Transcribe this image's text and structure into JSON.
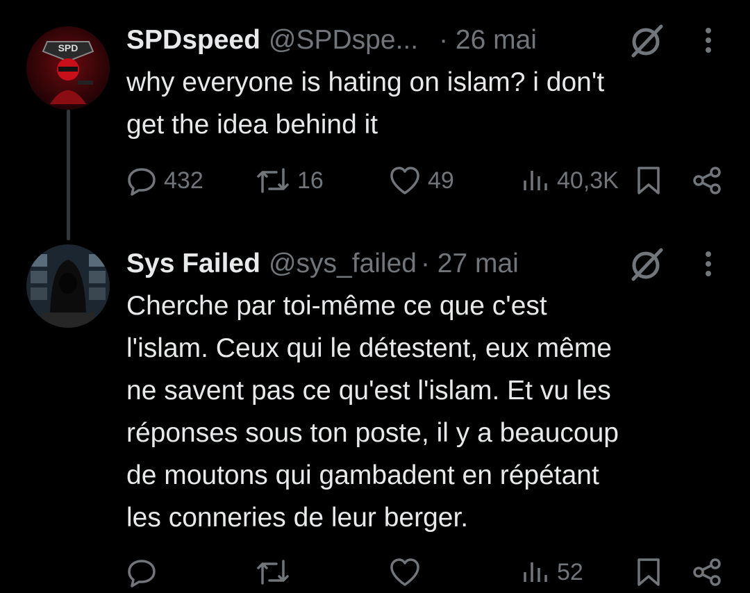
{
  "tweets": [
    {
      "name": "SPDspeed",
      "handle": "@SPDspe...",
      "date": "· 26 mai",
      "text_lines": [
        "why everyone is hating on islam? i don't",
        "get the idea behind it"
      ],
      "avatar_text": "SPD",
      "stats": {
        "replies": "432",
        "retweets": "16",
        "likes": "49",
        "views": "40,3K"
      }
    },
    {
      "name": "Sys Failed",
      "handle": "@sys_failed",
      "date": "· 27 mai",
      "text_lines": [
        "Cherche par toi-même ce que c'est",
        "l'islam. Ceux qui le détestent, eux même",
        "ne savent pas ce qu'est l'islam. Et vu les",
        "réponses sous ton poste, il y a beaucoup",
        "de moutons qui gambadent en répétant",
        "les conneries de leur berger."
      ],
      "stats": {
        "replies": "",
        "retweets": "",
        "likes": "",
        "views": "52"
      }
    }
  ],
  "icons": {
    "reply": "reply-icon",
    "retweet": "retweet-icon",
    "like": "heart-icon",
    "views": "views-icon",
    "bookmark": "bookmark-icon",
    "share": "share-icon",
    "grok": "grok-icon",
    "more": "more-icon"
  },
  "colors": {
    "background": "#000000",
    "text": "#e7e9ea",
    "muted": "#71767b",
    "thread_line": "#333639"
  }
}
